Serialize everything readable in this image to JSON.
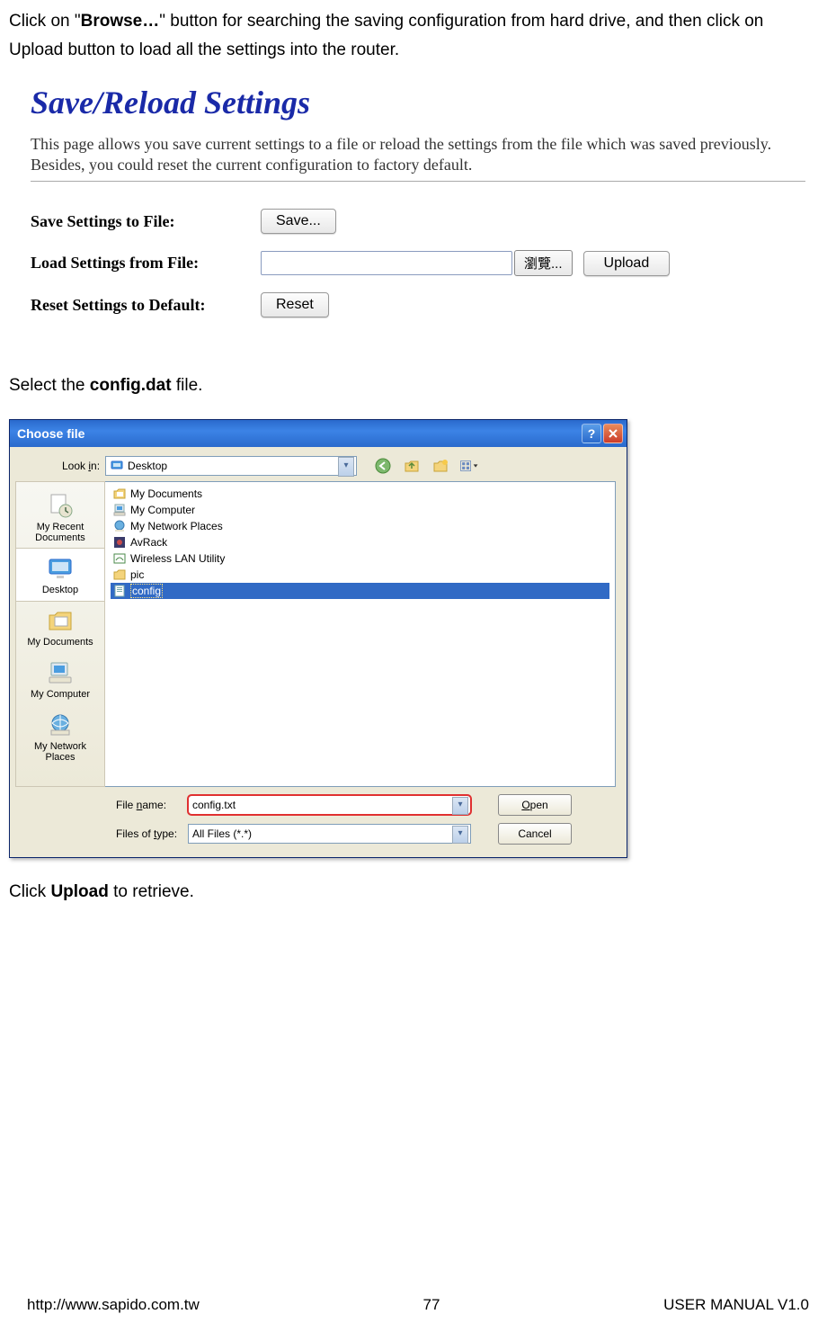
{
  "instruction1": {
    "prefix": "Click on \"",
    "boldPart": "Browse…",
    "suffix": "\" button for searching the saving configuration from hard drive, and then click on Upload button to load all the settings into the router."
  },
  "settingsPanel": {
    "title": "Save/Reload Settings",
    "desc": "This page allows you save current settings to a file or reload the settings from the file which was saved previously. Besides, you could reset the current configuration to factory default.",
    "rows": {
      "saveLabel": "Save Settings to File:",
      "saveBtn": "Save...",
      "loadLabel": "Load Settings from File:",
      "loadValue": "",
      "browseBtn": "瀏覽...",
      "uploadBtn": "Upload",
      "resetLabel": "Reset Settings to Default:",
      "resetBtn": "Reset"
    }
  },
  "instruction2": {
    "prefix": "Select the ",
    "boldPart": "config.dat",
    "suffix": " file."
  },
  "chooseDialog": {
    "title": "Choose file",
    "lookInLabel": "Look in:",
    "lookInValue": "Desktop",
    "places": [
      {
        "name": "My Recent Documents"
      },
      {
        "name": "Desktop"
      },
      {
        "name": "My Documents"
      },
      {
        "name": "My Computer"
      },
      {
        "name": "My Network Places"
      }
    ],
    "fileList": [
      {
        "name": "My Documents",
        "type": "folder-docs"
      },
      {
        "name": "My Computer",
        "type": "computer"
      },
      {
        "name": "My Network Places",
        "type": "network"
      },
      {
        "name": "AvRack",
        "type": "app"
      },
      {
        "name": "Wireless LAN Utility",
        "type": "app"
      },
      {
        "name": "pic",
        "type": "folder"
      },
      {
        "name": "config",
        "type": "file",
        "selected": true
      }
    ],
    "fileNameLabelParts": {
      "pre": "File ",
      "u": "n",
      "post": "ame:"
    },
    "fileNameValue": "config.txt",
    "fileTypeLabelParts": {
      "pre": "Files of ",
      "u": "t",
      "post": "ype:"
    },
    "fileTypeValue": "All Files (*.*)",
    "openBtn": {
      "u": "O",
      "post": "pen"
    },
    "cancelBtn": "Cancel"
  },
  "instruction3": {
    "prefix": "Click ",
    "boldPart": "Upload",
    "suffix": " to retrieve."
  },
  "footer": {
    "left": "http://www.sapido.com.tw",
    "center": "77",
    "right": "USER MANUAL V1.0"
  }
}
